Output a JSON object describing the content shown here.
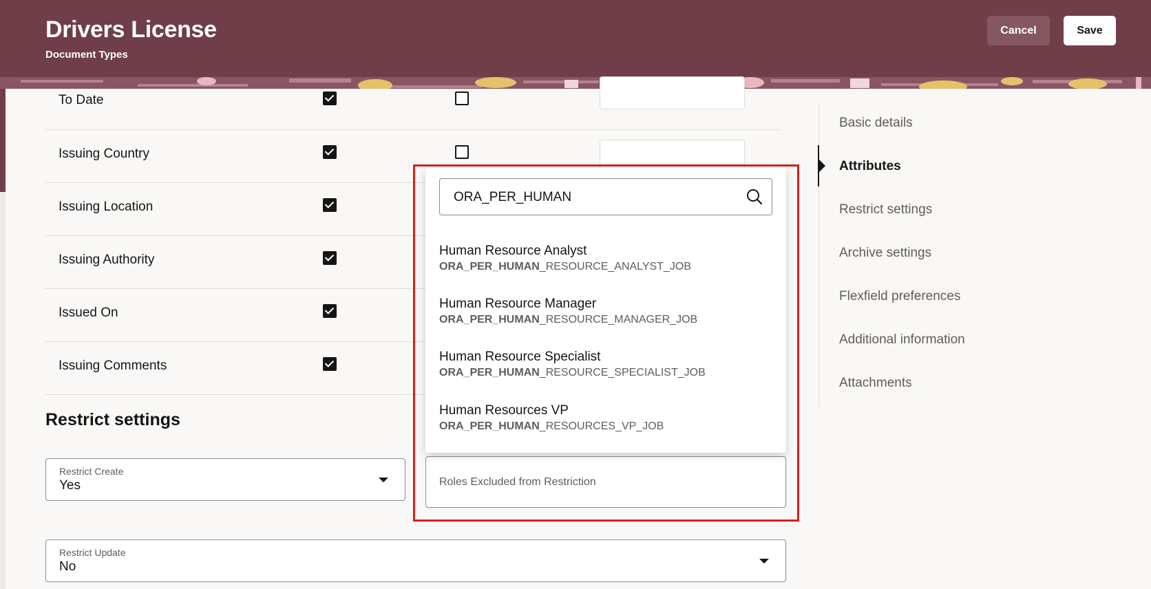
{
  "header": {
    "title": "Drivers License",
    "subtitle": "Document Types",
    "cancel_label": "Cancel",
    "save_label": "Save"
  },
  "attributes": [
    {
      "name": "To Date",
      "col1": true,
      "col2": false
    },
    {
      "name": "Issuing Country",
      "col1": true,
      "col2": false
    },
    {
      "name": "Issuing Location",
      "col1": true
    },
    {
      "name": "Issuing Authority",
      "col1": true
    },
    {
      "name": "Issued On",
      "col1": true
    },
    {
      "name": "Issuing Comments",
      "col1": true
    }
  ],
  "restrict": {
    "section_title": "Restrict settings",
    "create_label": "Restrict Create",
    "create_value": "Yes",
    "update_label": "Restrict Update",
    "update_value": "No",
    "roles_label": "Roles Excluded from Restriction"
  },
  "dropdown": {
    "search_value": "ORA_PER_HUMAN",
    "match": "ORA_PER_HUMAN",
    "options": [
      {
        "name": "Human Resource Analyst",
        "code_rest": "_RESOURCE_ANALYST_JOB"
      },
      {
        "name": "Human Resource Manager",
        "code_rest": "_RESOURCE_MANAGER_JOB"
      },
      {
        "name": "Human Resource Specialist",
        "code_rest": "_RESOURCE_SPECIALIST_JOB"
      },
      {
        "name": "Human Resources VP",
        "code_rest": "_RESOURCES_VP_JOB"
      }
    ]
  },
  "nav": {
    "items": [
      {
        "label": "Basic details"
      },
      {
        "label": "Attributes"
      },
      {
        "label": "Restrict settings"
      },
      {
        "label": "Archive settings"
      },
      {
        "label": "Flexfield preferences"
      },
      {
        "label": "Additional information"
      },
      {
        "label": "Attachments"
      }
    ],
    "active_index": 1
  },
  "colors": {
    "header_bg": "#6f3e49",
    "highlight": "#d81e1e"
  }
}
